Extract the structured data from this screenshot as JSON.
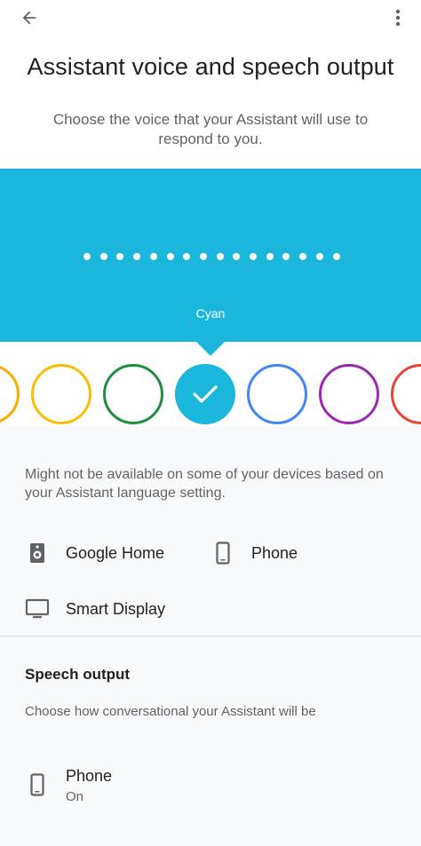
{
  "header": {
    "back_icon": "arrow-back-icon",
    "more_icon": "more-vert-icon",
    "title": "Assistant voice and speech output"
  },
  "subtitle": "Choose the voice that your Assistant will use to respond to you.",
  "voice_panel": {
    "background_color": "#1ab6dc",
    "selected_voice": "Cyan",
    "dot_count": 16
  },
  "voices": [
    {
      "color": "#f9ab00",
      "selected": false
    },
    {
      "color": "#fbbc04",
      "selected": false
    },
    {
      "color": "#1e8e3e",
      "selected": false
    },
    {
      "color": "#1ab6dc",
      "selected": true
    },
    {
      "color": "#4285f4",
      "selected": false
    },
    {
      "color": "#9c27b0",
      "selected": false
    },
    {
      "color": "#ea4335",
      "selected": false
    }
  ],
  "availability_note": "Might not be available on some of your devices based on your Assistant language setting.",
  "devices": [
    {
      "icon": "speaker-icon",
      "label": "Google Home"
    },
    {
      "icon": "phone-icon",
      "label": "Phone"
    },
    {
      "icon": "display-icon",
      "label": "Smart Display"
    }
  ],
  "speech_output": {
    "title": "Speech output",
    "description": "Choose how conversational your Assistant will be",
    "items": [
      {
        "icon": "phone-icon",
        "label": "Phone",
        "state": "On"
      }
    ]
  }
}
